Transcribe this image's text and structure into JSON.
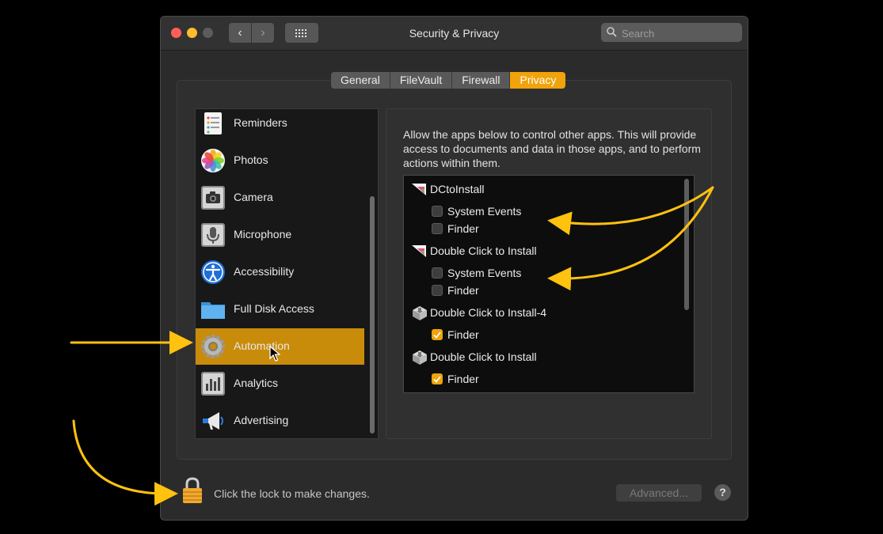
{
  "window": {
    "title": "Security & Privacy"
  },
  "search": {
    "placeholder": "Search"
  },
  "tabs": [
    {
      "label": "General"
    },
    {
      "label": "FileVault"
    },
    {
      "label": "Firewall"
    },
    {
      "label": "Privacy",
      "active": true
    }
  ],
  "sidebar": {
    "items": [
      {
        "label": "Reminders",
        "icon": "reminders-icon"
      },
      {
        "label": "Photos",
        "icon": "photos-icon"
      },
      {
        "label": "Camera",
        "icon": "camera-icon"
      },
      {
        "label": "Microphone",
        "icon": "microphone-icon"
      },
      {
        "label": "Accessibility",
        "icon": "accessibility-icon"
      },
      {
        "label": "Full Disk Access",
        "icon": "folder-icon"
      },
      {
        "label": "Automation",
        "icon": "gear-icon",
        "selected": true
      },
      {
        "label": "Analytics",
        "icon": "analytics-icon"
      },
      {
        "label": "Advertising",
        "icon": "megaphone-icon"
      }
    ]
  },
  "main": {
    "description": "Allow the apps below to control other apps. This will provide access to documents and data in those apps, and to perform actions within them.",
    "apps": [
      {
        "name": "DCtoInstall",
        "icon": "app-icon",
        "permissions": [
          {
            "label": "System Events",
            "checked": false
          },
          {
            "label": "Finder",
            "checked": false
          }
        ]
      },
      {
        "name": "Double Click to Install",
        "icon": "app-icon",
        "permissions": [
          {
            "label": "System Events",
            "checked": false
          },
          {
            "label": "Finder",
            "checked": false
          }
        ]
      },
      {
        "name": "Double Click to Install-4",
        "icon": "installer-icon",
        "permissions": [
          {
            "label": "Finder",
            "checked": true
          }
        ]
      },
      {
        "name": "Double Click to Install",
        "icon": "installer-icon",
        "permissions": [
          {
            "label": "Finder",
            "checked": true
          }
        ]
      }
    ]
  },
  "footer": {
    "lock_text": "Click the lock to make changes.",
    "advanced_label": "Advanced...",
    "help_label": "?"
  },
  "colors": {
    "accent": "#f0a30a",
    "selected": "#c98b0a",
    "annotation": "#ffc20e"
  }
}
